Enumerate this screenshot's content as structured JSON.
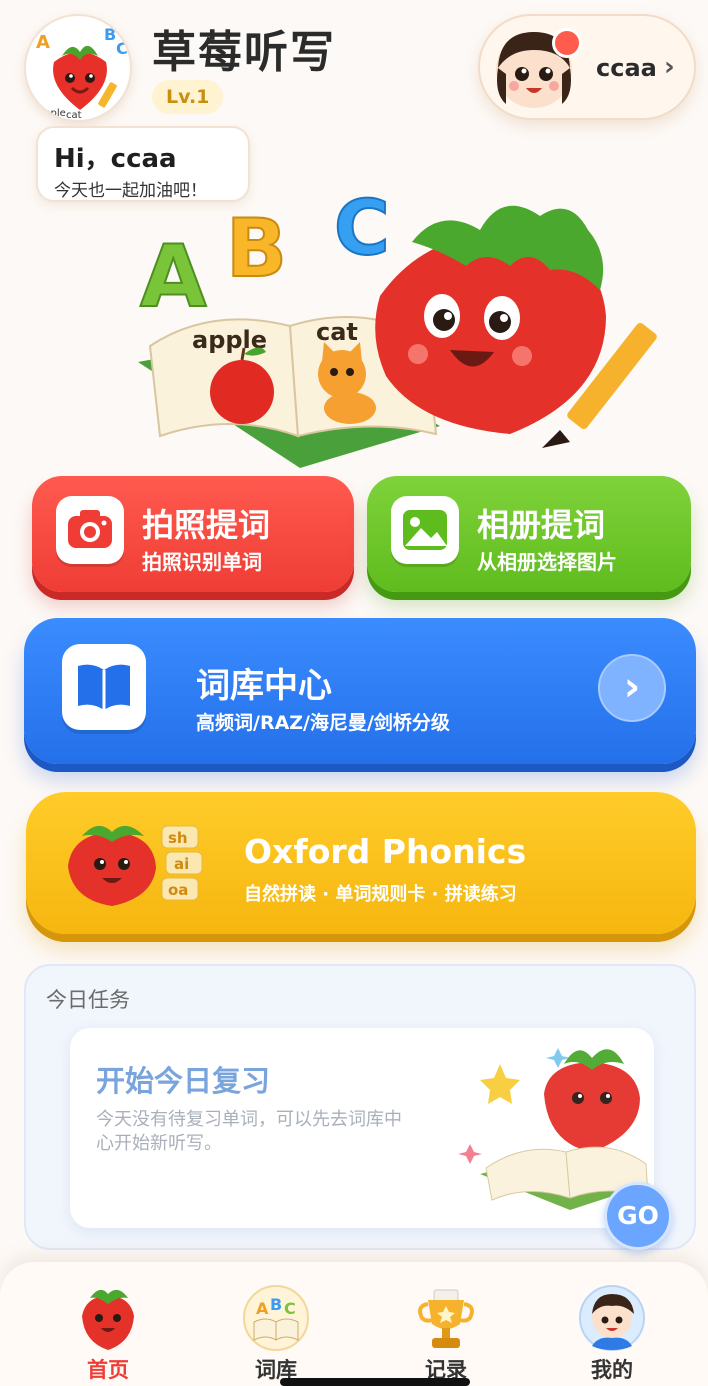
{
  "header": {
    "app_title": "草莓听写",
    "level": "Lv.1",
    "logo_letters": [
      "A",
      "B",
      "C"
    ],
    "logo_words": [
      "apple",
      "cat"
    ],
    "user": {
      "name": "ccaa",
      "chevron": "›",
      "notification_dot_color": "#ff5c4d"
    },
    "greeting": {
      "title": "Hi，ccaa",
      "subtitle": "今天也一起加油吧！"
    }
  },
  "hero": {
    "letters": [
      "A",
      "B",
      "C"
    ],
    "book_words": [
      "apple",
      "cat"
    ],
    "icons": [
      "strawberry-mascot",
      "open-book",
      "apple",
      "cat",
      "pencil"
    ]
  },
  "actions": {
    "camera": {
      "title": "拍照提词",
      "subtitle": "拍照识别单词",
      "icon": "camera-icon",
      "color": "#ef3d35"
    },
    "album": {
      "title": "相册提词",
      "subtitle": "从相册选择图片",
      "icon": "image-icon",
      "color": "#5fbc1e"
    }
  },
  "library": {
    "title": "词库中心",
    "subtitle": "高频词/RAZ/海尼曼/剑桥分级",
    "arrow": "›",
    "icon": "book-icon",
    "color": "#2470ea"
  },
  "phonics": {
    "title": "Oxford Phonics",
    "subtitle": "自然拼读 · 单词规则卡 · 拼读练习",
    "tiles": [
      "sh",
      "ai",
      "oa"
    ],
    "color": "#f6b60f"
  },
  "today_task": {
    "heading": "今日任务",
    "card_title": "开始今日复习",
    "card_desc": "今天没有待复习单词，可以先去词库中心开始新听写。",
    "go_label": "GO"
  },
  "bottom_nav": {
    "items": [
      {
        "label": "首页",
        "icon": "strawberry-icon",
        "active": true
      },
      {
        "label": "词库",
        "icon": "abc-book-icon",
        "active": false
      },
      {
        "label": "记录",
        "icon": "trophy-icon",
        "active": false
      },
      {
        "label": "我的",
        "icon": "boy-avatar-icon",
        "active": false
      }
    ]
  }
}
